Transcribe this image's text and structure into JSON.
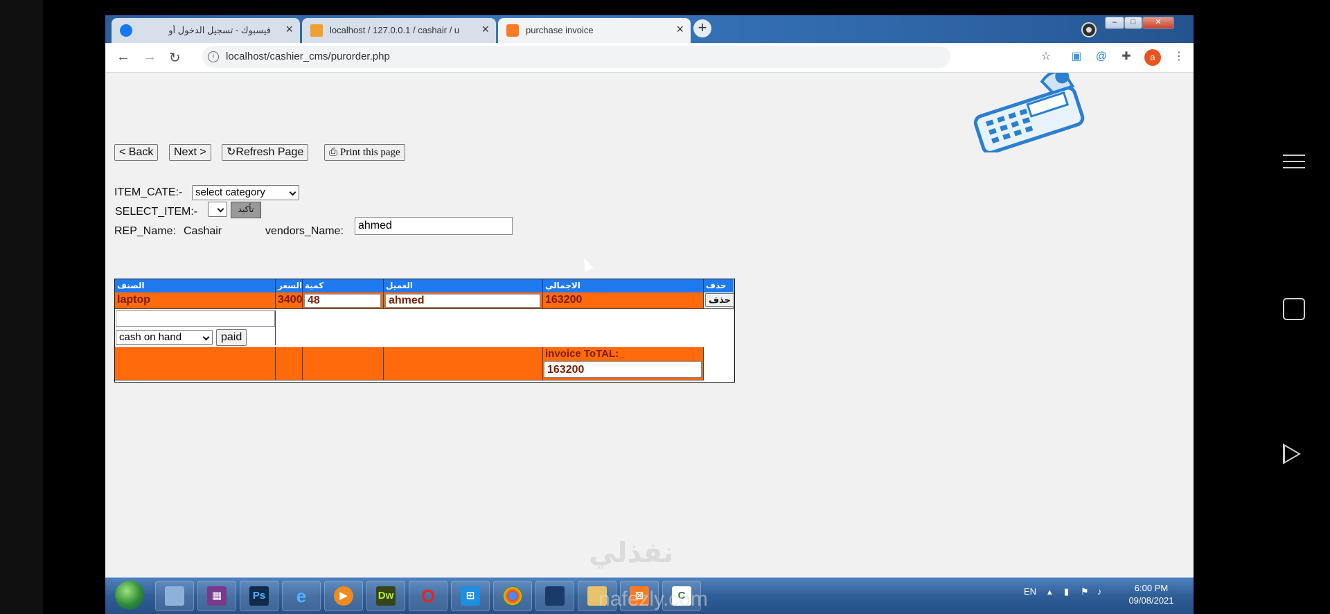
{
  "browser": {
    "tabs": [
      {
        "title": "فيسبوك - تسجيل الدخول أو الاشتراك",
        "active": false
      },
      {
        "title": "localhost / 127.0.0.1 / cashair / u",
        "active": false
      },
      {
        "title": "purchase invoice",
        "active": true
      }
    ],
    "url": "localhost/cashier_cms/purorder.php"
  },
  "toolbar": {
    "back": "< Back",
    "next": "Next >",
    "refresh": "↻Refresh Page",
    "print": "Print this page"
  },
  "form": {
    "item_cate_label": "ITEM_CATE:-",
    "item_cate_value": "select category",
    "select_item_label": "SELECT_ITEM:-",
    "confirm_label": "تأكيد",
    "rep_label": "REP_Name:",
    "rep_value": "Cashair",
    "vendor_label": "vendors_Name:",
    "vendor_value": "ahmed"
  },
  "table": {
    "headers": [
      "الصنف",
      "السعر",
      "كمية",
      "العميل",
      "الاجمالي",
      "حذف"
    ],
    "row": {
      "item": "laptop",
      "price": "3400",
      "qty": "48",
      "customer": "ahmed",
      "total": "163200",
      "delete": "حذف"
    },
    "payment_method": "cash on hand",
    "paid_button": "paid",
    "invoice_total_label": "invoice ToTAL:_",
    "invoice_total_value": "163200"
  },
  "taskbar": {
    "lang": "EN",
    "time": "6:00 PM",
    "date": "09/08/2021"
  },
  "watermark": {
    "arabic": "نفذلي",
    "latin": "nafezly.com"
  },
  "colors": {
    "header_blue": "#1f7af0",
    "row_orange": "#ff6a0d"
  }
}
